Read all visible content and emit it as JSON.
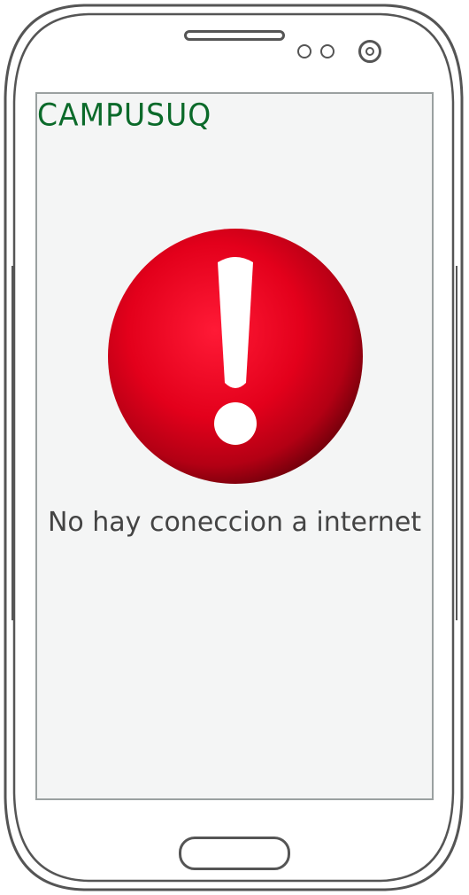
{
  "app": {
    "title": "CAMPUSUQ"
  },
  "error": {
    "icon": "exclamation-alert-icon",
    "message": "No hay coneccion a internet"
  },
  "colors": {
    "brand": "#0b6a2a",
    "alert_red": "#e3001b",
    "screen_bg": "#f4f5f5",
    "message_text": "#444444"
  }
}
